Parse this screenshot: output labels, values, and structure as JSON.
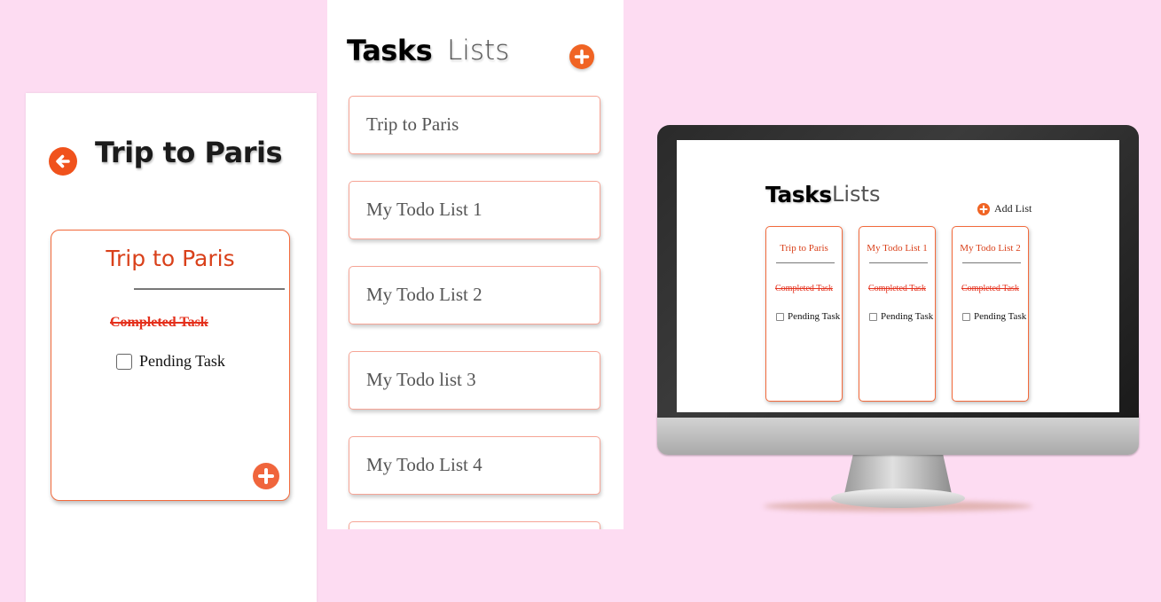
{
  "detail_view": {
    "title": "Trip to Paris",
    "card_title": "Trip to Paris",
    "completed_task": "Completed Task",
    "pending_task": "Pending Task"
  },
  "lists_view": {
    "tab_tasks": "Tasks",
    "tab_lists": "Lists",
    "lists": [
      {
        "label": "Trip to Paris"
      },
      {
        "label": "My Todo List 1"
      },
      {
        "label": "My Todo List 2"
      },
      {
        "label": "My Todo list 3"
      },
      {
        "label": "My Todo List 4"
      },
      {
        "label": ""
      }
    ]
  },
  "desktop_view": {
    "tab_tasks": "Tasks",
    "tab_lists": "Lists",
    "add_list_label": "Add List",
    "cards": [
      {
        "title": "Trip to Paris",
        "completed_task": "Completed Task",
        "pending_task": "Pending Task"
      },
      {
        "title": "My Todo List 1",
        "completed_task": "Completed Task",
        "pending_task": "Pending Task"
      },
      {
        "title": "My Todo List 2",
        "completed_task": "Completed Task",
        "pending_task": "Pending Task"
      }
    ]
  },
  "colors": {
    "background": "#fddcf2",
    "accent": "#f06424",
    "card_title": "#d9401a",
    "completed_text": "#e4301c",
    "card_border": "#f26a3c"
  },
  "icons": {
    "back": "arrow-left-circle-icon",
    "add": "plus-circle-icon"
  }
}
